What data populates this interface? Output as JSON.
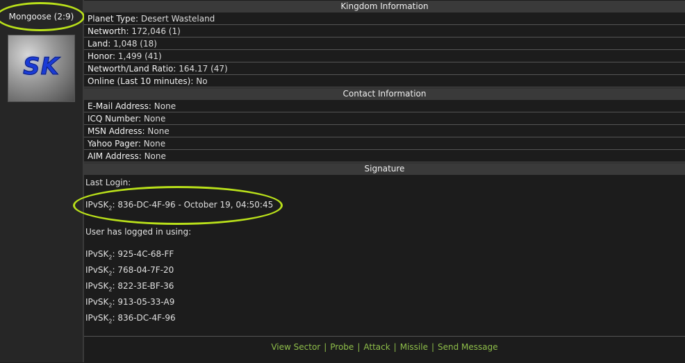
{
  "user": {
    "name": "Mongoose (2:9)",
    "avatar_text": "SK"
  },
  "kingdom": {
    "header": "Kingdom Information",
    "rows": [
      {
        "label": "Planet Type:",
        "value": "Desert Wasteland"
      },
      {
        "label": "Networth:",
        "value": "172,046 (1)"
      },
      {
        "label": "Land:",
        "value": "1,048 (18)"
      },
      {
        "label": "Honor:",
        "value": "1,499 (41)"
      },
      {
        "label": "Networth/Land Ratio:",
        "value": "164.17 (47)"
      },
      {
        "label": "Online (Last 10 minutes):",
        "value": "No"
      }
    ]
  },
  "contact": {
    "header": "Contact Information",
    "rows": [
      {
        "label": "E-Mail Address:",
        "value": "None"
      },
      {
        "label": "ICQ Number:",
        "value": "None"
      },
      {
        "label": "MSN Address:",
        "value": "None"
      },
      {
        "label": "Yahoo Pager:",
        "value": "None"
      },
      {
        "label": "AIM Address:",
        "value": "None"
      }
    ]
  },
  "signature": {
    "header": "Signature",
    "last_login_label": "Last Login:",
    "last_login": {
      "prefix": "IPvSK",
      "sub": "2",
      "value": ": 836-DC-4F-96 - October 19, 04:50:45"
    },
    "logged_using_label": "User has logged in using:",
    "ips": [
      {
        "prefix": "IPvSK",
        "sub": "2",
        "value": ": 925-4C-68-FF"
      },
      {
        "prefix": "IPvSK",
        "sub": "2",
        "value": ": 768-04-7F-20"
      },
      {
        "prefix": "IPvSK",
        "sub": "2",
        "value": ": 822-3E-BF-36"
      },
      {
        "prefix": "IPvSK",
        "sub": "2",
        "value": ": 913-05-33-A9"
      },
      {
        "prefix": "IPvSK",
        "sub": "2",
        "value": ": 836-DC-4F-96"
      }
    ]
  },
  "footer": {
    "links": [
      "View Sector",
      "Probe",
      "Attack",
      "Missile",
      "Send Message"
    ],
    "separator": "|"
  },
  "colors": {
    "highlight": "#b9e01a",
    "link": "#8fbf4a",
    "header_bg": "#3a3a3a"
  }
}
